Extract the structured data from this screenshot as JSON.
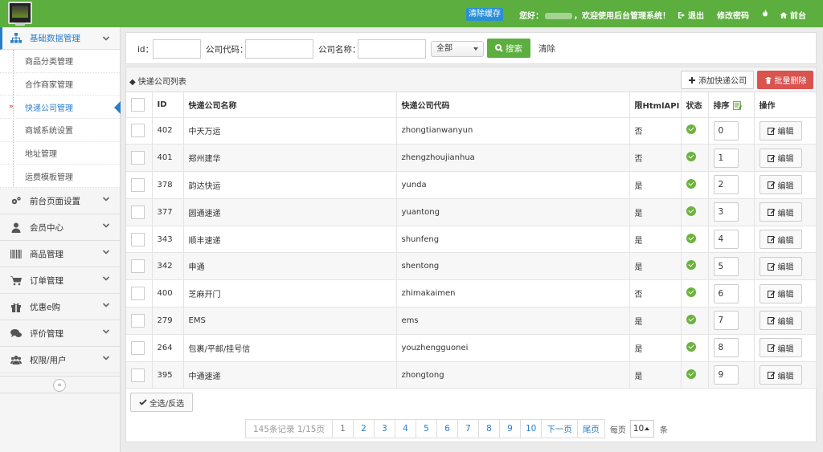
{
  "header": {
    "clear_cache": "清除缓存",
    "welcome_prefix": "您好：",
    "welcome_suffix": "，欢迎使用后台管理系统！",
    "logout": "退出",
    "change_password": "修改密码",
    "frontend": "前台"
  },
  "sidebar": {
    "groups": [
      {
        "label": "基础数据管理",
        "icon": "sitemap-icon",
        "expanded": true
      },
      {
        "label": "前台页面设置",
        "icon": "cogs-icon"
      },
      {
        "label": "会员中心",
        "icon": "user-icon"
      },
      {
        "label": "商品管理",
        "icon": "barcode-icon"
      },
      {
        "label": "订单管理",
        "icon": "cart-icon"
      },
      {
        "label": "优惠e购",
        "icon": "gift-icon"
      },
      {
        "label": "评价管理",
        "icon": "comments-icon"
      },
      {
        "label": "权限/用户",
        "icon": "users-icon"
      }
    ],
    "sub_items": [
      "商品分类管理",
      "合作商家管理",
      "快递公司管理",
      "商城系统设置",
      "地址管理",
      "运费模板管理"
    ],
    "active_sub": "快递公司管理",
    "collapse_glyph": "«"
  },
  "search": {
    "id_label": "id：",
    "code_label": "公司代码：",
    "name_label": "公司名称：",
    "select_value": "全部",
    "search_button": "搜索",
    "clear_button": "清除"
  },
  "list": {
    "title": "◆ 快递公司列表",
    "add_button": "添加快递公司",
    "batch_delete": "批量删除",
    "columns": [
      "ID",
      "快递公司名称",
      "快递公司代码",
      "限HtmlAPI",
      "状态",
      "排序",
      "操作"
    ],
    "edit_label": "编辑",
    "rows": [
      {
        "id": "402",
        "name": "中天万运",
        "code": "zhongtianwanyun",
        "api": "否",
        "sort": "0"
      },
      {
        "id": "401",
        "name": "郑州建华",
        "code": "zhengzhoujianhua",
        "api": "否",
        "sort": "1"
      },
      {
        "id": "378",
        "name": "韵达快运",
        "code": "yunda",
        "api": "是",
        "sort": "2"
      },
      {
        "id": "377",
        "name": "圆通速递",
        "code": "yuantong",
        "api": "是",
        "sort": "3"
      },
      {
        "id": "343",
        "name": "顺丰速递",
        "code": "shunfeng",
        "api": "是",
        "sort": "4"
      },
      {
        "id": "342",
        "name": "申通",
        "code": "shentong",
        "api": "是",
        "sort": "5"
      },
      {
        "id": "400",
        "name": "芝麻开门",
        "code": "zhimakaimen",
        "api": "否",
        "sort": "6"
      },
      {
        "id": "279",
        "name": "EMS",
        "code": "ems",
        "api": "是",
        "sort": "7"
      },
      {
        "id": "264",
        "name": "包裹/平邮/挂号信",
        "code": "youzhengguonei",
        "api": "是",
        "sort": "8"
      },
      {
        "id": "395",
        "name": "中通速递",
        "code": "zhongtong",
        "api": "是",
        "sort": "9"
      }
    ],
    "select_all": "全选/反选"
  },
  "pagination": {
    "info": "145条记录 1/15页",
    "current": "1",
    "pages": [
      "2",
      "3",
      "4",
      "5",
      "6",
      "7",
      "8",
      "9",
      "10"
    ],
    "next": "下一页",
    "last": "尾页",
    "per_page_label": "每页",
    "per_page_value": "10",
    "per_page_unit": "条"
  },
  "colors": {
    "header_green": "#5cae3e",
    "link_blue": "#2a7dc9",
    "danger_red": "#d9534f"
  }
}
